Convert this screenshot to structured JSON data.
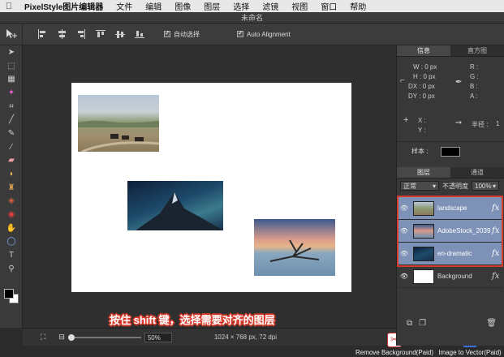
{
  "menubar": {
    "apple": "",
    "app_name": "PixelStyle图片编辑器",
    "items": [
      "文件",
      "编辑",
      "图像",
      "图层",
      "选择",
      "滤镜",
      "视图",
      "窗口",
      "帮助"
    ]
  },
  "window": {
    "title": "未命名"
  },
  "options": {
    "auto_select": "自动选择",
    "auto_alignment": "Auto Alignment"
  },
  "statusbar": {
    "zoom": "50%",
    "doc_info": "1024 × 768 px, 72 dpi"
  },
  "tutorial_caption": "按住 shift 键，选择需要对齐的图层",
  "plugins": {
    "remove_bg": "Remove Background(Paid)",
    "vector": "Image to Vector(Paid)",
    "vector_badge": "Sv"
  },
  "panel": {
    "info_tabs": [
      "信息",
      "直方图"
    ],
    "info": {
      "w": "W : 0 px",
      "h": "H : 0 px",
      "dx": "DX : 0 px",
      "dy": "DY : 0 px",
      "r": "R :",
      "g": "G :",
      "b": "B :",
      "a": "A :",
      "x": "X :",
      "y": "Y :",
      "radius_label": "半径 :",
      "radius_value": "1"
    },
    "sample_label": "样本 :",
    "layer_tabs": [
      "图层",
      "通道"
    ],
    "blend_mode": "正常",
    "opacity_label": "不透明度",
    "opacity_value": "100%",
    "layers": [
      {
        "name": "landscape",
        "selected": true
      },
      {
        "name": "AdobeStock_2039",
        "selected": true
      },
      {
        "name": "en-dramatic",
        "selected": true
      },
      {
        "name": "Background",
        "selected": false
      }
    ]
  },
  "colors": {
    "highlight": "#d63a2a",
    "selected_layer": "#7e92b8"
  }
}
